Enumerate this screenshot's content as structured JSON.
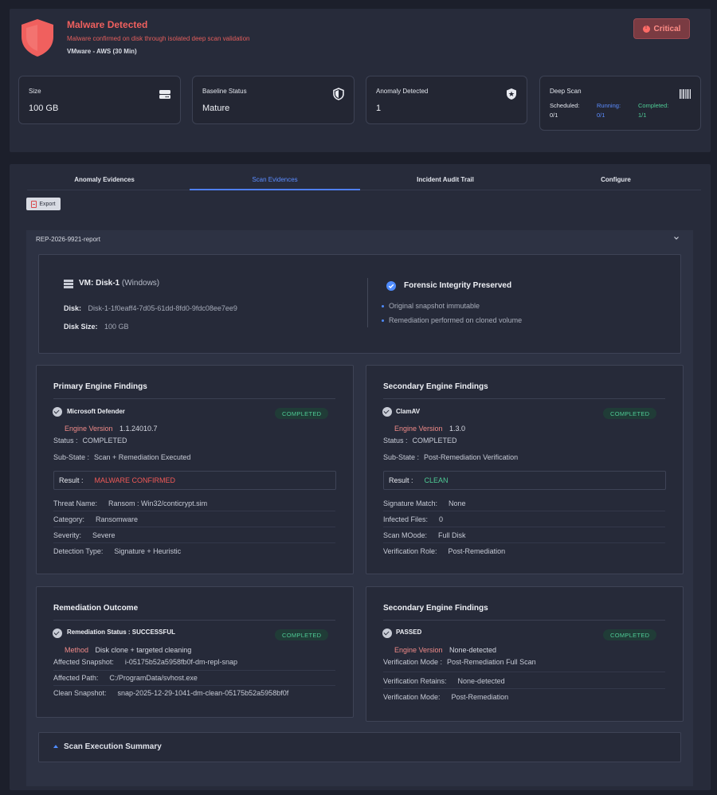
{
  "colors": {
    "accent": "#5b8cff",
    "danger": "#f0605e",
    "success": "#4ecb95",
    "background": "#1c1f2b",
    "panel": "#272b3a"
  },
  "alert": {
    "icon": "shield-alert-icon",
    "title": "Malware Detected",
    "subtitle": "Malware confirmed on disk through isolated deep scan validation",
    "environment": "VMware - AWS (30 Min)",
    "severity": "Critical"
  },
  "stats": {
    "size": {
      "label": "Size",
      "value": "100 GB",
      "icon": "storage-drive-icon"
    },
    "baseline": {
      "label": "Baseline Status",
      "value": "Mature",
      "icon": "shield-half-icon"
    },
    "anomaly": {
      "label": "Anomaly Detected",
      "value": "1",
      "icon": "shield-star-icon"
    },
    "deep_scan": {
      "label": "Deep Scan",
      "icon": "barcode-icon",
      "scheduled_label": "Scheduled:",
      "scheduled_value": "0/1",
      "running_label": "Running:",
      "running_value": "0/1",
      "completed_label": "Completed:",
      "completed_value": "1/1"
    }
  },
  "tabs": [
    "Anomaly Evidences",
    "Scan Evidences",
    "Incident Audit Trail",
    "Configure"
  ],
  "active_tab": "Scan Evidences",
  "export_label": "Export",
  "report": {
    "id": "REP-2026-9921-report",
    "vm": {
      "title": "VM: Disk-1",
      "os": "(Windows)",
      "disk_label": "Disk:",
      "disk_value": "Disk-1-1f0eaff4-7d05-61dd-8fd0-9fdc08ee7ee9",
      "disk_size_label": "Disk Size:",
      "disk_size_value": "100 GB"
    },
    "forensic": {
      "title": "Forensic Integrity Preserved",
      "items": [
        "Original snapshot immutable",
        "Remediation performed on cloned volume"
      ]
    },
    "primary": {
      "title": "Primary Engine Findings",
      "engine": "Microsoft Defender",
      "version_label": "Engine Version",
      "version": "1.1.24010.7",
      "badge": "COMPLETED",
      "status_label": "Status :",
      "status": "COMPLETED",
      "substate_label": "Sub-State :",
      "substate": "Scan + Remediation Executed",
      "result_label": "Result :",
      "result": "MALWARE CONFIRMED",
      "rows": [
        {
          "label": "Threat Name:",
          "value": "Ransom : Win32/conticrypt.sim"
        },
        {
          "label": "Category:",
          "value": "Ransomware"
        },
        {
          "label": "Severity:",
          "value": "Severe"
        },
        {
          "label": "Detection Type:",
          "value": "Signature + Heuristic"
        }
      ]
    },
    "secondary": {
      "title": "Secondary Engine Findings",
      "engine": "ClamAV",
      "version_label": "Engine Version",
      "version": "1.3.0",
      "badge": "COMPLETED",
      "status_label": "Status :",
      "status": "COMPLETED",
      "substate_label": "Sub-State :",
      "substate": "Post-Remediation Verification",
      "result_label": "Result :",
      "result": "CLEAN",
      "rows": [
        {
          "label": "Signature Match:",
          "value": "None"
        },
        {
          "label": "Infected Files:",
          "value": "0"
        },
        {
          "label": "Scan MOode:",
          "value": "Full Disk"
        },
        {
          "label": "Verification Role:",
          "value": "Post-Remediation"
        }
      ]
    },
    "remediation": {
      "title": "Remediation Outcome",
      "status_text": "Remediation Status : SUCCESSFUL",
      "method_label": "Method",
      "method": "Disk clone + targeted cleaning",
      "badge": "COMPLETED",
      "rows": [
        {
          "label": "Affected Snapshot:",
          "value": "i-05175b52a5958fb0f-dm-repl-snap"
        },
        {
          "label": "Affected Path:",
          "value": "C:/ProgramData/svhost.exe"
        },
        {
          "label": "Clean Snapshot:",
          "value": "snap-2025-12-29-1041-dm-clean-05175b52a5958bf0f"
        }
      ]
    },
    "secondary2": {
      "title": "Secondary Engine Findings",
      "status_text": "PASSED",
      "version_label": "Engine Version",
      "version": "None-detected",
      "badge": "COMPLETED",
      "rows": [
        {
          "label": "Verification Mode :",
          "value": "Post-Remediation Full Scan"
        },
        {
          "label": "Verification Retains:",
          "value": "None-detected"
        },
        {
          "label": "Verification Mode:",
          "value": "Post-Remediation"
        }
      ]
    },
    "summary_title": "Scan Execution Summary"
  }
}
